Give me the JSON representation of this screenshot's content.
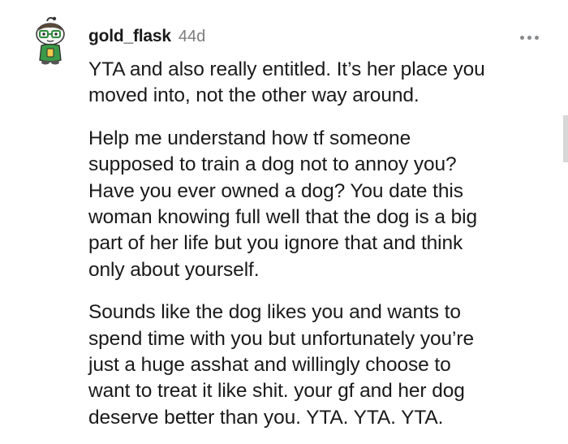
{
  "comment": {
    "username": "gold_flask",
    "age": "44d",
    "more_icon": "more-horizontal-icon",
    "paragraphs": [
      "YTA and also really entitled. It’s her place you\nmoved into, not the other way around.",
      "Help me understand how tf someone\nsupposed to train a dog not to annoy you?\nHave you ever owned a dog? You date this\nwoman knowing full well that the dog is a big\npart of her life but you ignore that and think\nonly about yourself.",
      "Sounds like the dog likes you and wants to\nspend time with you but unfortunately you’re\njust a huge asshat and willingly choose to\nwant to treat it like shit. your gf and her dog\ndeserve better than you. YTA. YTA. YTA."
    ]
  },
  "colors": {
    "text": "#1a1a1b",
    "meta": "#7c7c7c",
    "avatar_green": "#2e8b3a"
  }
}
